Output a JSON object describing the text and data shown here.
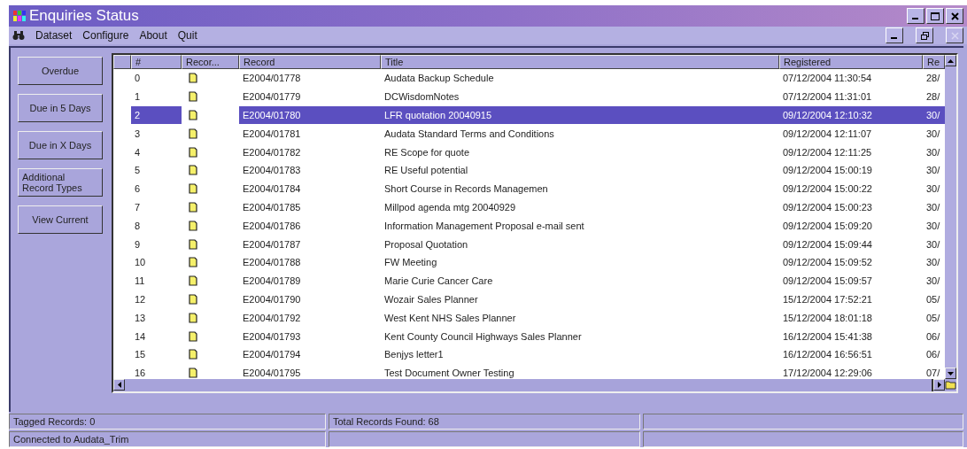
{
  "window": {
    "title": "Enquiries Status"
  },
  "menu": [
    {
      "label": "Dataset"
    },
    {
      "label": "Configure"
    },
    {
      "label": "About"
    },
    {
      "label": "Quit"
    }
  ],
  "mdi_controls": {
    "close_disabled": true
  },
  "side_buttons": [
    "Overdue",
    "Due in 5 Days",
    "Due in X Days",
    "Additional Record Types",
    "View Current"
  ],
  "table": {
    "columns": [
      "#",
      "Recor...",
      "Record",
      "Title",
      "Registered",
      "Re"
    ],
    "rows": [
      {
        "number": "0",
        "record": "E2004/01778",
        "title": "Audata Backup Schedule",
        "registered": "07/12/2004 11:30:54",
        "column_6": "28/",
        "selected": false
      },
      {
        "number": "1",
        "record": "E2004/01779",
        "title": "DCWisdomNotes",
        "registered": "07/12/2004 11:31:01",
        "column_6": "28/",
        "selected": false
      },
      {
        "number": "2",
        "record": "E2004/01780",
        "title": "LFR quotation 20040915",
        "registered": "09/12/2004 12:10:32",
        "column_6": "30/",
        "selected": true
      },
      {
        "number": "3",
        "record": "E2004/01781",
        "title": "Audata Standard Terms and Conditions",
        "registered": "09/12/2004 12:11:07",
        "column_6": "30/",
        "selected": false
      },
      {
        "number": "4",
        "record": "E2004/01782",
        "title": "RE Scope for quote",
        "registered": "09/12/2004 12:11:25",
        "column_6": "30/",
        "selected": false
      },
      {
        "number": "5",
        "record": "E2004/01783",
        "title": "RE Useful potential",
        "registered": "09/12/2004 15:00:19",
        "column_6": "30/",
        "selected": false
      },
      {
        "number": "6",
        "record": "E2004/01784",
        "title": "Short Course in Records Managemen",
        "registered": "09/12/2004 15:00:22",
        "column_6": "30/",
        "selected": false
      },
      {
        "number": "7",
        "record": "E2004/01785",
        "title": "Millpod agenda mtg 20040929",
        "registered": "09/12/2004 15:00:23",
        "column_6": "30/",
        "selected": false
      },
      {
        "number": "8",
        "record": "E2004/01786",
        "title": "Information Management Proposal e-mail sent",
        "registered": "09/12/2004 15:09:20",
        "column_6": "30/",
        "selected": false
      },
      {
        "number": "9",
        "record": "E2004/01787",
        "title": "Proposal Quotation",
        "registered": "09/12/2004 15:09:44",
        "column_6": "30/",
        "selected": false
      },
      {
        "number": "10",
        "record": "E2004/01788",
        "title": "FW Meeting",
        "registered": "09/12/2004 15:09:52",
        "column_6": "30/",
        "selected": false
      },
      {
        "number": "11",
        "record": "E2004/01789",
        "title": "Marie Curie Cancer Care",
        "registered": "09/12/2004 15:09:57",
        "column_6": "30/",
        "selected": false
      },
      {
        "number": "12",
        "record": "E2004/01790",
        "title": "Wozair Sales Planner",
        "registered": "15/12/2004 17:52:21",
        "column_6": "05/",
        "selected": false
      },
      {
        "number": "13",
        "record": "E2004/01792",
        "title": "West Kent NHS Sales Planner",
        "registered": "15/12/2004 18:01:18",
        "column_6": "05/",
        "selected": false
      },
      {
        "number": "14",
        "record": "E2004/01793",
        "title": "Kent County Council Highways Sales Planner",
        "registered": "16/12/2004 15:41:38",
        "column_6": "06/",
        "selected": false
      },
      {
        "number": "15",
        "record": "E2004/01794",
        "title": "Benjys letter1",
        "registered": "16/12/2004 16:56:51",
        "column_6": "06/",
        "selected": false
      },
      {
        "number": "16",
        "record": "E2004/01795",
        "title": "Test Document Owner Testing",
        "registered": "17/12/2004 12:29:06",
        "column_6": "07/",
        "selected": false
      }
    ]
  },
  "status_bar": [
    [
      "Tagged Records: 0",
      "Total Records Found: 68"
    ],
    [
      "Connected to Audata_Trim"
    ]
  ]
}
